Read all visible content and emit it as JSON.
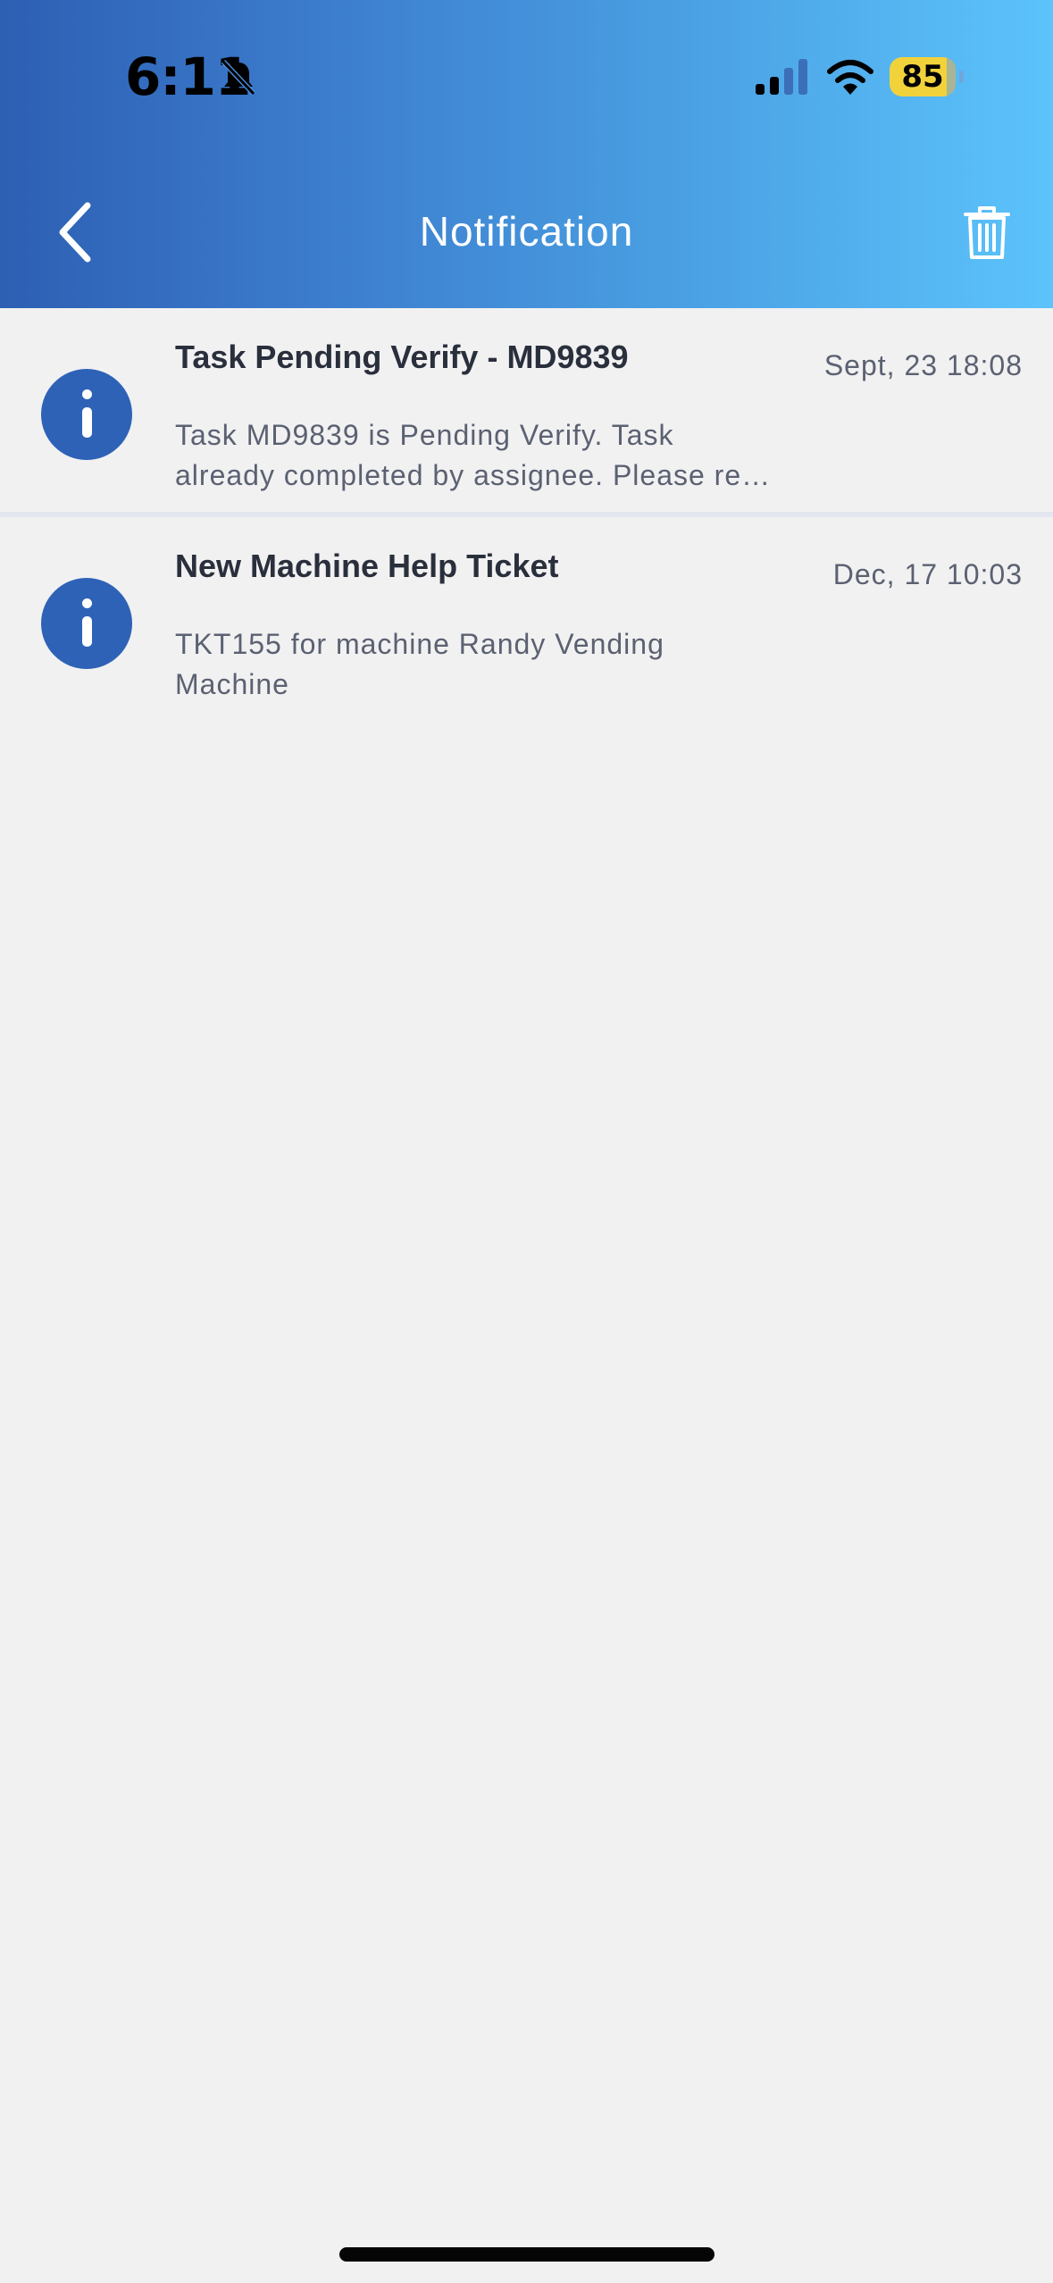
{
  "status_bar": {
    "time": "6:11",
    "battery_level": "85",
    "battery_color": "#f2d23b"
  },
  "header": {
    "title": "Notification",
    "back_icon": "chevron-left-icon",
    "delete_icon": "trash-icon",
    "gradient_start": "#2d5fb3",
    "gradient_end": "#5cc3fb"
  },
  "notifications": [
    {
      "icon": "info-icon",
      "title": "Task Pending Verify - MD9839",
      "date": "Sept, 23 18:08",
      "body_line1": "Task MD9839 is Pending Verify. Task",
      "body_line2": "already completed by assignee. Please re…"
    },
    {
      "icon": "info-icon",
      "title": "New Machine Help Ticket",
      "date": "Dec, 17 10:03",
      "body_line1": "TKT155 for machine Randy Vending",
      "body_line2": "Machine"
    }
  ],
  "accent_color": "#2e62b7"
}
